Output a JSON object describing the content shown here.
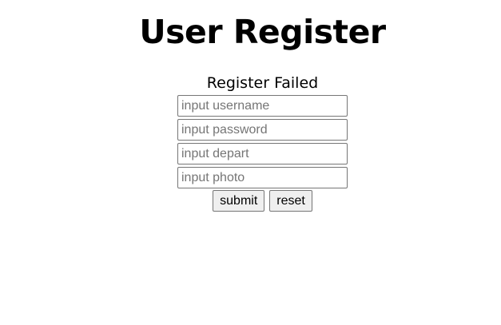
{
  "header": {
    "title": "User Register"
  },
  "status": {
    "message": "Register Failed"
  },
  "form": {
    "fields": [
      {
        "placeholder": "input username",
        "value": ""
      },
      {
        "placeholder": "input password",
        "value": ""
      },
      {
        "placeholder": "input depart",
        "value": ""
      },
      {
        "placeholder": "input photo",
        "value": ""
      }
    ],
    "submit_label": "submit",
    "reset_label": "reset"
  }
}
